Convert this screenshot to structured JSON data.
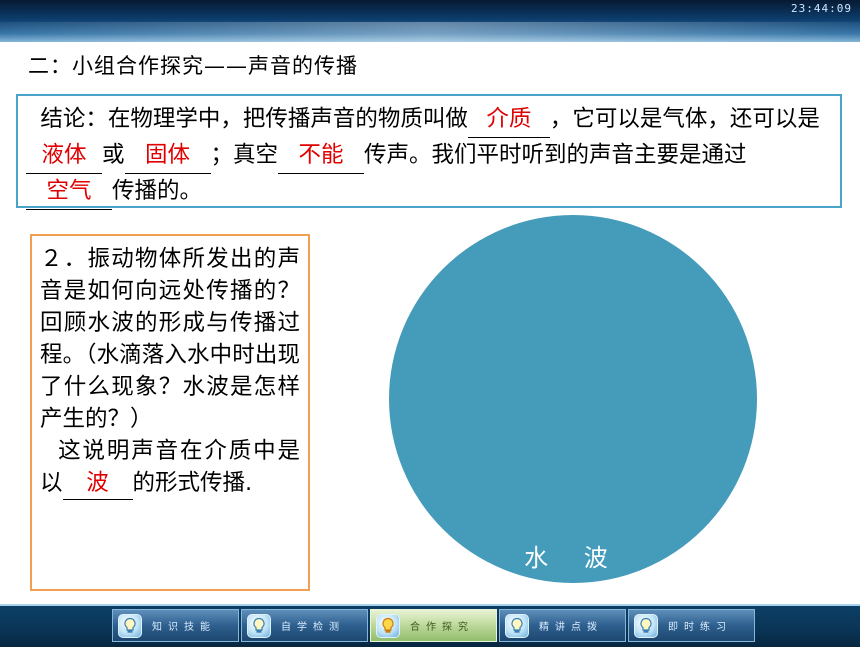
{
  "clock": "23:44:09",
  "section_title": "二：小组合作探究——声音的传播",
  "conclusion": {
    "p1": "结论：在物理学中，把传播声音的物质叫做",
    "b1": "介质",
    "p2": "，它可以是气体，还可以是",
    "b2": "液体",
    "p3": "或",
    "b3": "固体",
    "p4": "；真空",
    "b4": "不能",
    "p5": "传声。我们平时听到的声音主要是通过",
    "b5": "空气",
    "p6": "传播的。"
  },
  "question": {
    "text": "２．振动物体所发出的声音是如何向远处传播的？回顾水波的形成与传播过程。（水滴落入水中时出现了什么现象？水波是怎样产生的？）",
    "ans_prefix": "这说明声音在介质中是以",
    "ans_blank": "波",
    "ans_suffix": "的形式传播."
  },
  "diagram_label": "水 波",
  "nav": [
    {
      "label": "知识技能"
    },
    {
      "label": "自学检测"
    },
    {
      "label": "合作探究"
    },
    {
      "label": "精讲点拨"
    },
    {
      "label": "即时练习"
    }
  ],
  "colors": {
    "answer": "#e00000",
    "circle": "#459bba",
    "conclusion_border": "#4aa3c9",
    "question_border": "#f0a050"
  },
  "icons": {
    "nav": "lightbulb-icon"
  }
}
